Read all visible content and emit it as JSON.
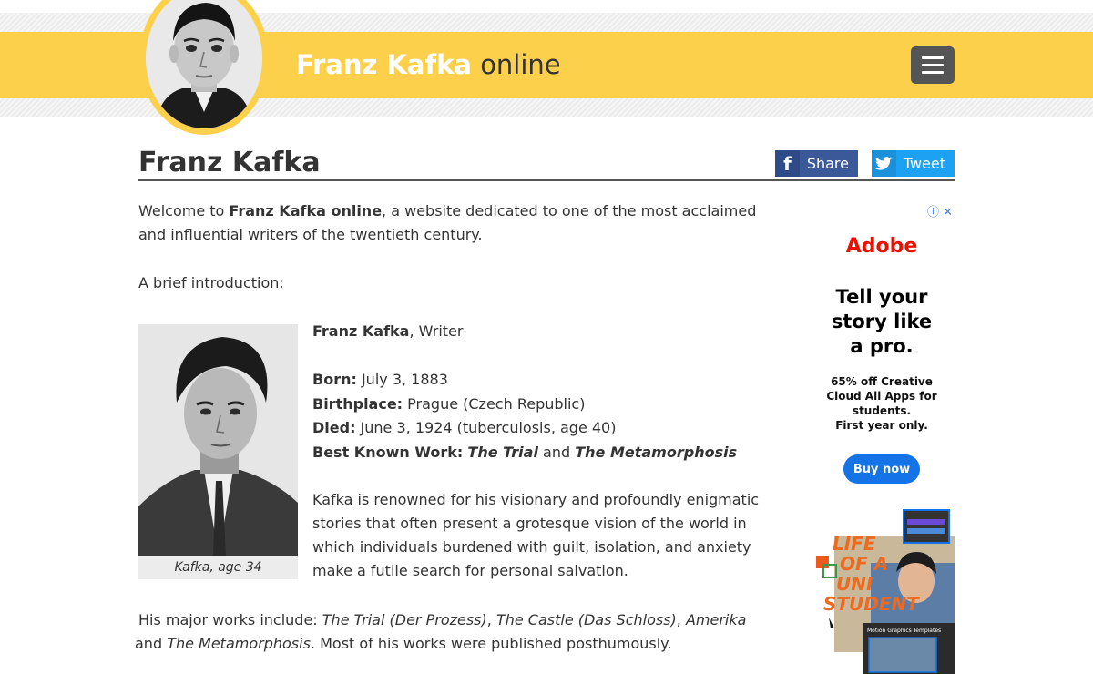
{
  "header": {
    "site_title_bold": "Franz Kafka",
    "site_title_suffix": "online",
    "menu_label": "Menu"
  },
  "page": {
    "title": "Franz Kafka",
    "share_label": "Share",
    "tweet_label": "Tweet"
  },
  "content": {
    "p1_prefix": "Welcome to ",
    "p1_bold": "Franz Kafka online",
    "p1_rest": ", a website dedicated to one of the most acclaimed and influential writers of the twentieth century.",
    "p2": "A brief introduction:",
    "photo_caption": "Kafka, age 34",
    "facts": {
      "name": "Franz Kafka",
      "name_role": ", Writer",
      "born_label": "Born:",
      "born_value": " July 3, 1883",
      "birthplace_label": "Birthplace:",
      "birthplace_value": " Prague (Czech Republic)",
      "died_label": "Died:",
      "died_value": " June 3, 1924 (tuberculosis, age 40)",
      "work_label": "Best Known Work:",
      "work_1": "The Trial",
      "work_and": " and ",
      "work_2": "The Metamorphosis"
    },
    "p4": "Kafka is renowned for his visionary and profoundly enigmatic stories that often present a grotesque vision of the world in which individuals burdened with guilt, isolation, and anxiety make a futile search for personal salvation.",
    "p5": {
      "prefix": "His major works include: ",
      "w1": "The Trial (Der Prozess)",
      "sep1": ", ",
      "w2": "The Castle (Das Schloss)",
      "sep2": ", ",
      "w3": "Amerika",
      "and": " and ",
      "w4": "The Metamorphosis",
      "suffix": ". Most of his works were published posthumously."
    }
  },
  "ad": {
    "controls": "ⓘ ✕",
    "logo": "Adobe",
    "headline_1": "Tell your",
    "headline_2": "story like",
    "headline_3": "a pro.",
    "body_1": "65% off Creative",
    "body_2": "Cloud All Apps for",
    "body_3": "students.",
    "body_4": "First year only.",
    "button": "Buy now",
    "art_line_1": "LIFE",
    "art_line_2": "OF A",
    "art_line_3": "UNI",
    "art_line_4": "STUDENT",
    "art_caption": "Motion Graphics Templates"
  },
  "colors": {
    "header_yellow": "#fdd04c",
    "facebook": "#3b5998",
    "twitter": "#1da1f2",
    "adobe_red": "#eb1000",
    "adobe_blue": "#1473e6"
  }
}
